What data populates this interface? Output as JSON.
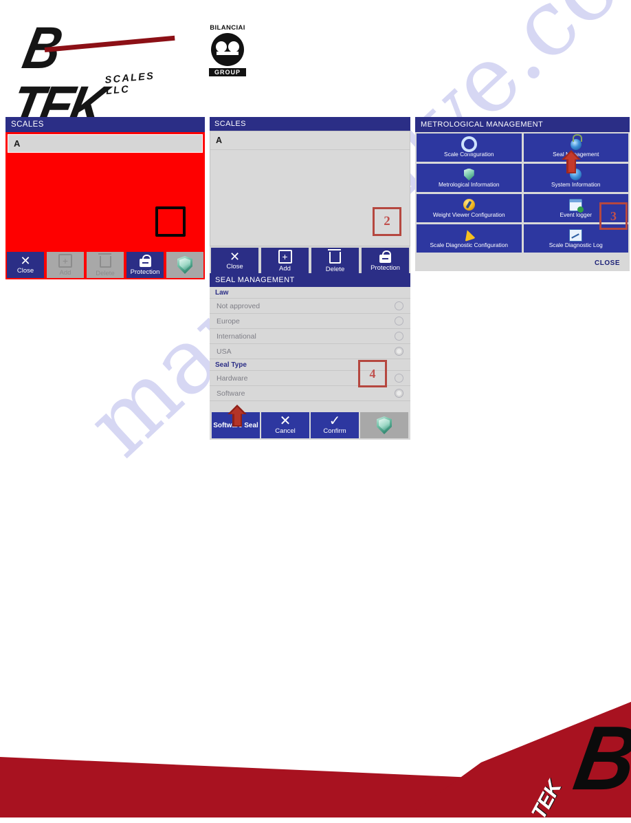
{
  "brand": {
    "logo_main": "B TEK",
    "logo_sub": "SCALES LLC",
    "partner_top": "BILANCIAI",
    "partner_bottom": "GROUP",
    "footer_mark": "B",
    "footer_tek": "TEK"
  },
  "watermark": {
    "text": "manualslive.com"
  },
  "colors": {
    "title_bar": "#2b2e86",
    "button_blue": "#2d37a0",
    "alert_red": "#fe0000",
    "callout_red": "#b5473f",
    "panel_gray": "#d8d8d8",
    "footer_red": "#a81220"
  },
  "panel_scales_red": {
    "title": "SCALES",
    "rows": [
      "A"
    ],
    "buttons": [
      {
        "label": "Close",
        "icon": "close-x-icon",
        "state": "enabled"
      },
      {
        "label": "Add",
        "icon": "plus-box-icon",
        "state": "disabled"
      },
      {
        "label": "Delete",
        "icon": "trash-icon",
        "state": "disabled"
      },
      {
        "label": "Protection",
        "icon": "lock-icon",
        "state": "enabled"
      },
      {
        "label": "",
        "icon": "shield-icon",
        "state": "shield"
      }
    ]
  },
  "panel_scales": {
    "title": "SCALES",
    "rows": [
      "A"
    ],
    "callout": "2",
    "buttons": [
      {
        "label": "Close",
        "icon": "close-x-icon",
        "state": "enabled"
      },
      {
        "label": "Add",
        "icon": "plus-box-icon",
        "state": "enabled"
      },
      {
        "label": "Delete",
        "icon": "trash-icon",
        "state": "enabled"
      },
      {
        "label": "Protection",
        "icon": "lock-icon",
        "state": "enabled"
      }
    ]
  },
  "panel_metrological": {
    "title": "METROLOGICAL MANAGEMENT",
    "callout": "3",
    "close_label": "CLOSE",
    "items": [
      {
        "label": "Scale Configuration",
        "icon": "gear-icon"
      },
      {
        "label": "Seal Management",
        "icon": "seal-lock-icon"
      },
      {
        "label": "Metrological Information",
        "icon": "shield-icon"
      },
      {
        "label": "System Information",
        "icon": "info-globe-icon"
      },
      {
        "label": "Weight Viewer Configuration",
        "icon": "wrench-icon"
      },
      {
        "label": "Event logger",
        "icon": "calendar-check-icon"
      },
      {
        "label": "Scale Diagnostic Configuration",
        "icon": "bell-icon"
      },
      {
        "label": "Scale Diagnostic Log",
        "icon": "chart-icon"
      }
    ]
  },
  "panel_seal": {
    "title": "SEAL MANAGEMENT",
    "callout": "4",
    "groups": [
      {
        "label": "Law",
        "options": [
          {
            "label": "Not approved",
            "selected": false
          },
          {
            "label": "Europe",
            "selected": false
          },
          {
            "label": "International",
            "selected": false
          },
          {
            "label": "USA",
            "selected": true
          }
        ]
      },
      {
        "label": "Seal Type",
        "options": [
          {
            "label": "Hardware",
            "selected": false
          },
          {
            "label": "Software",
            "selected": true
          }
        ]
      }
    ],
    "buttons": [
      {
        "label": "Software Seal",
        "icon": "text-only",
        "state": "enabled"
      },
      {
        "label": "Cancel",
        "icon": "close-x-icon",
        "state": "enabled"
      },
      {
        "label": "Confirm",
        "icon": "check-icon",
        "state": "enabled"
      },
      {
        "label": "",
        "icon": "shield-icon",
        "state": "shield"
      }
    ]
  }
}
